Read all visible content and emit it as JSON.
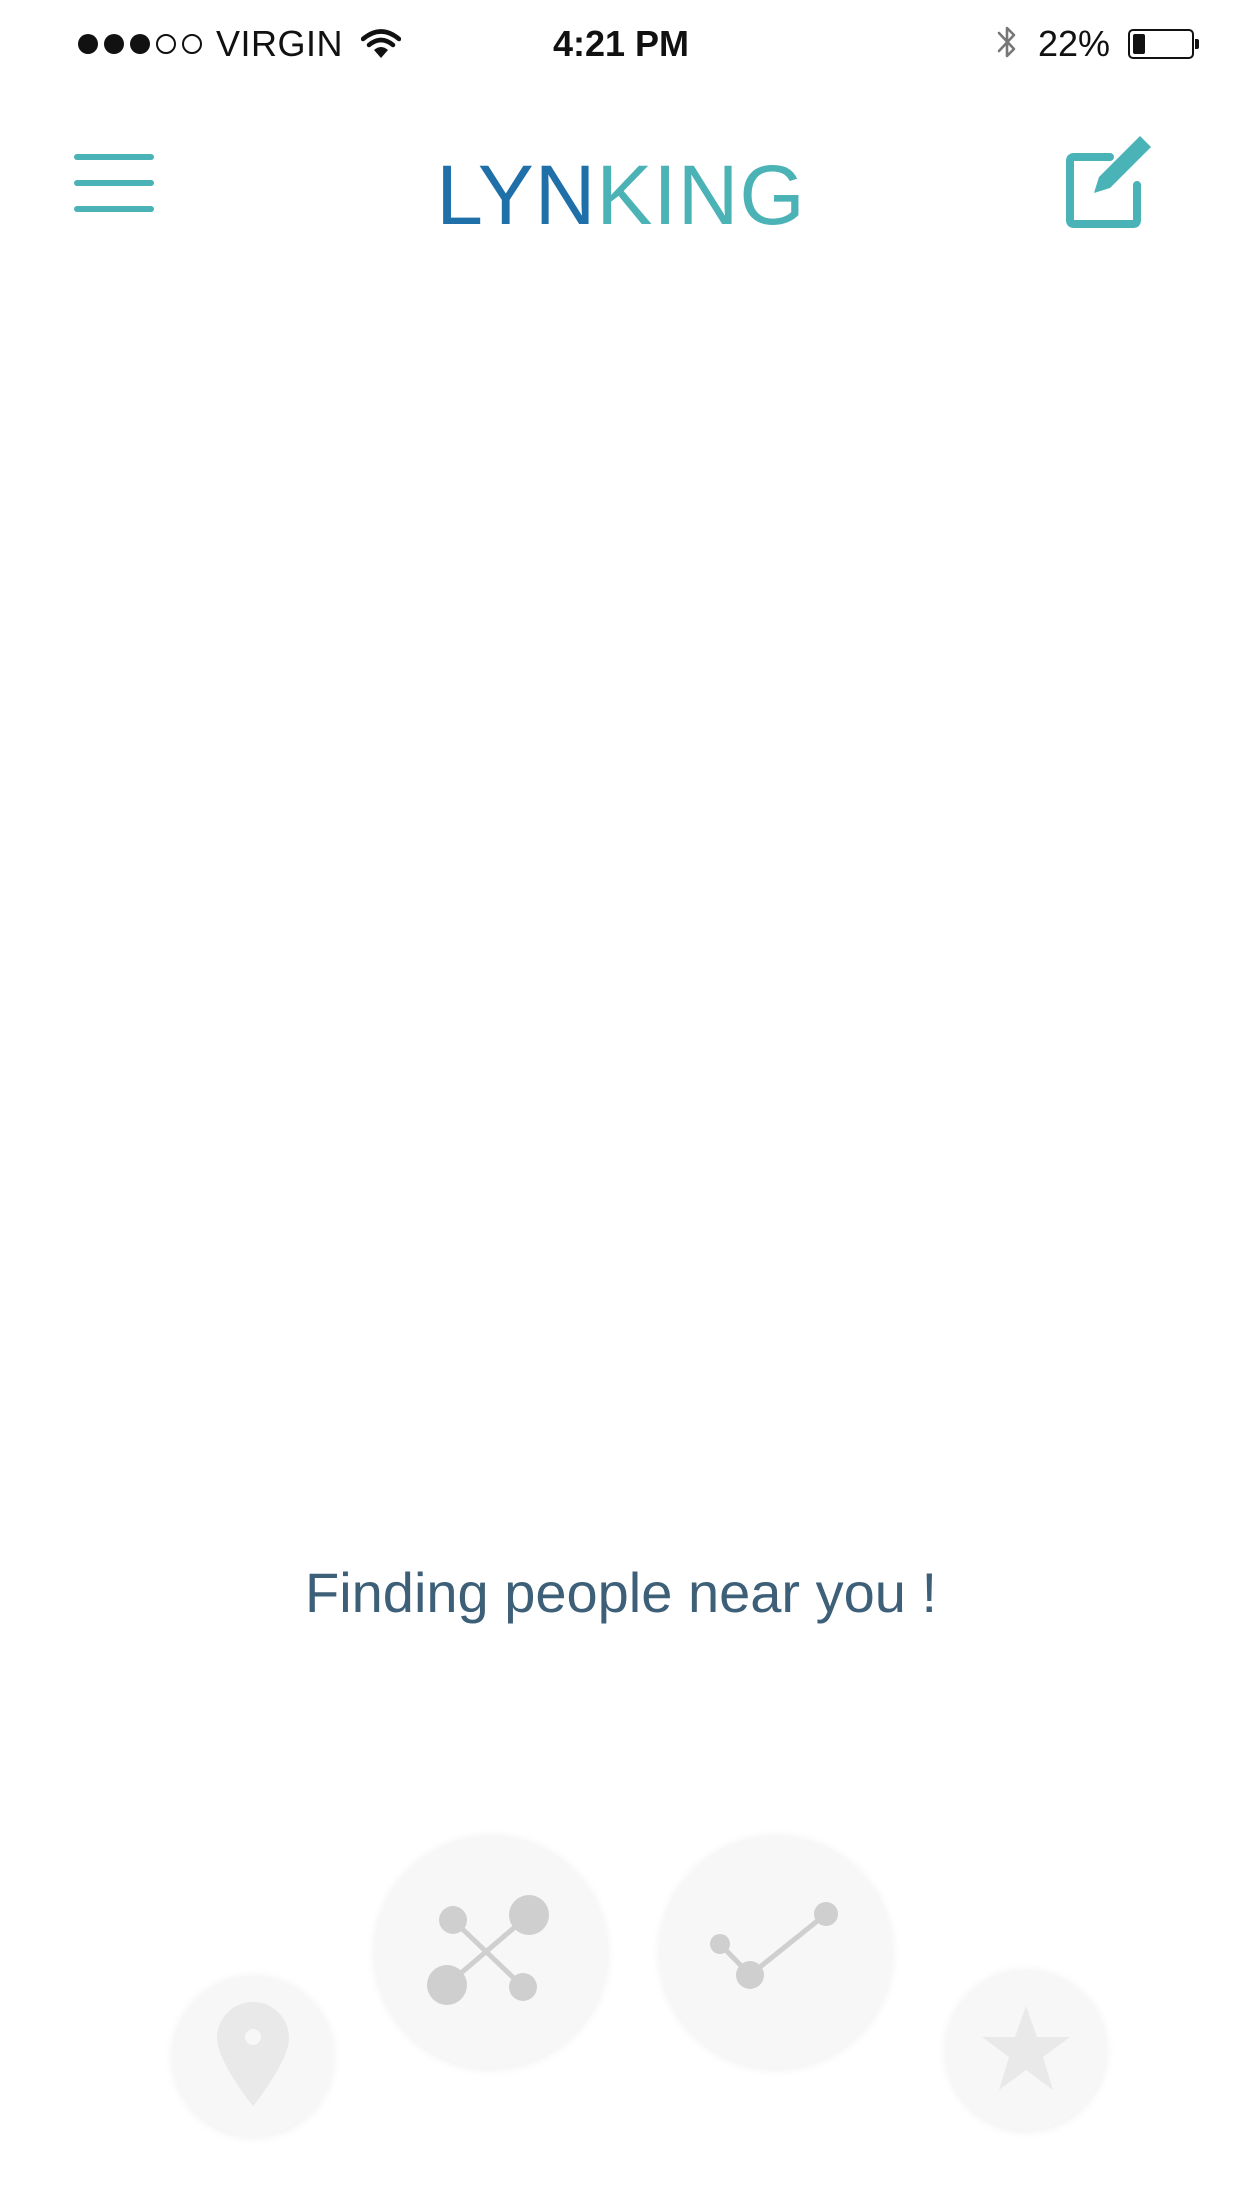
{
  "status_bar": {
    "carrier": "VIRGIN",
    "signal_icon": "signal-dots-icon",
    "wifi_icon": "wifi-icon",
    "time": "4:21 PM",
    "bluetooth_icon": "bluetooth-icon",
    "battery_percent_text": "22%",
    "battery_level": 0.22
  },
  "header": {
    "menu_icon": "hamburger-menu-icon",
    "brand_part1": "LYN",
    "brand_part2": "KING",
    "compose_icon": "compose-icon",
    "colors": {
      "accent_teal": "#4bb2b6",
      "brand_blue": "#1f6fa8"
    }
  },
  "main": {
    "status_message": "Finding people near you !"
  },
  "bottom_actions": [
    {
      "icon": "location-pin-icon"
    },
    {
      "icon": "network-icon"
    },
    {
      "icon": "connect-check-icon"
    },
    {
      "icon": "star-icon"
    }
  ]
}
